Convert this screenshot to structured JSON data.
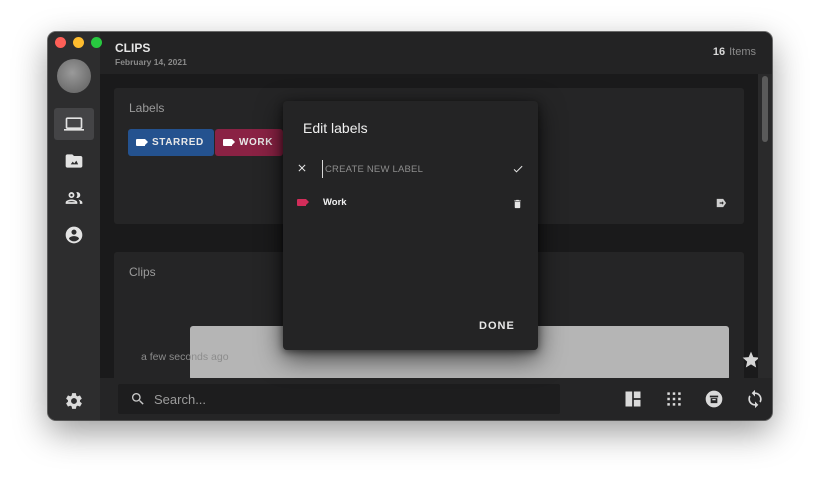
{
  "app": {
    "title": "CLIPS",
    "date": "February 14, 2021",
    "count": "16",
    "count_unit": "Items"
  },
  "labels_section": {
    "title": "Labels",
    "chips": [
      {
        "label": "STARRED",
        "color": "#24528f"
      },
      {
        "label": "WORK",
        "color": "#8a2244"
      }
    ]
  },
  "clips_section": {
    "title": "Clips",
    "clip_time": "a few seconds ago"
  },
  "search": {
    "placeholder": "Search..."
  },
  "dialog": {
    "title": "Edit labels",
    "new_label_placeholder": "CREATE NEW LABEL",
    "labels": [
      {
        "name": "Work",
        "color": "#d22d5a"
      }
    ],
    "done_label": "DONE"
  },
  "icons": {
    "sidebar": [
      "laptop-icon",
      "folder-icon",
      "people-icon",
      "account-icon"
    ],
    "toolbar": [
      "layout-icon",
      "grid-icon",
      "archive-icon",
      "sync-icon",
      "more-icon"
    ],
    "settings": "gear-icon"
  }
}
